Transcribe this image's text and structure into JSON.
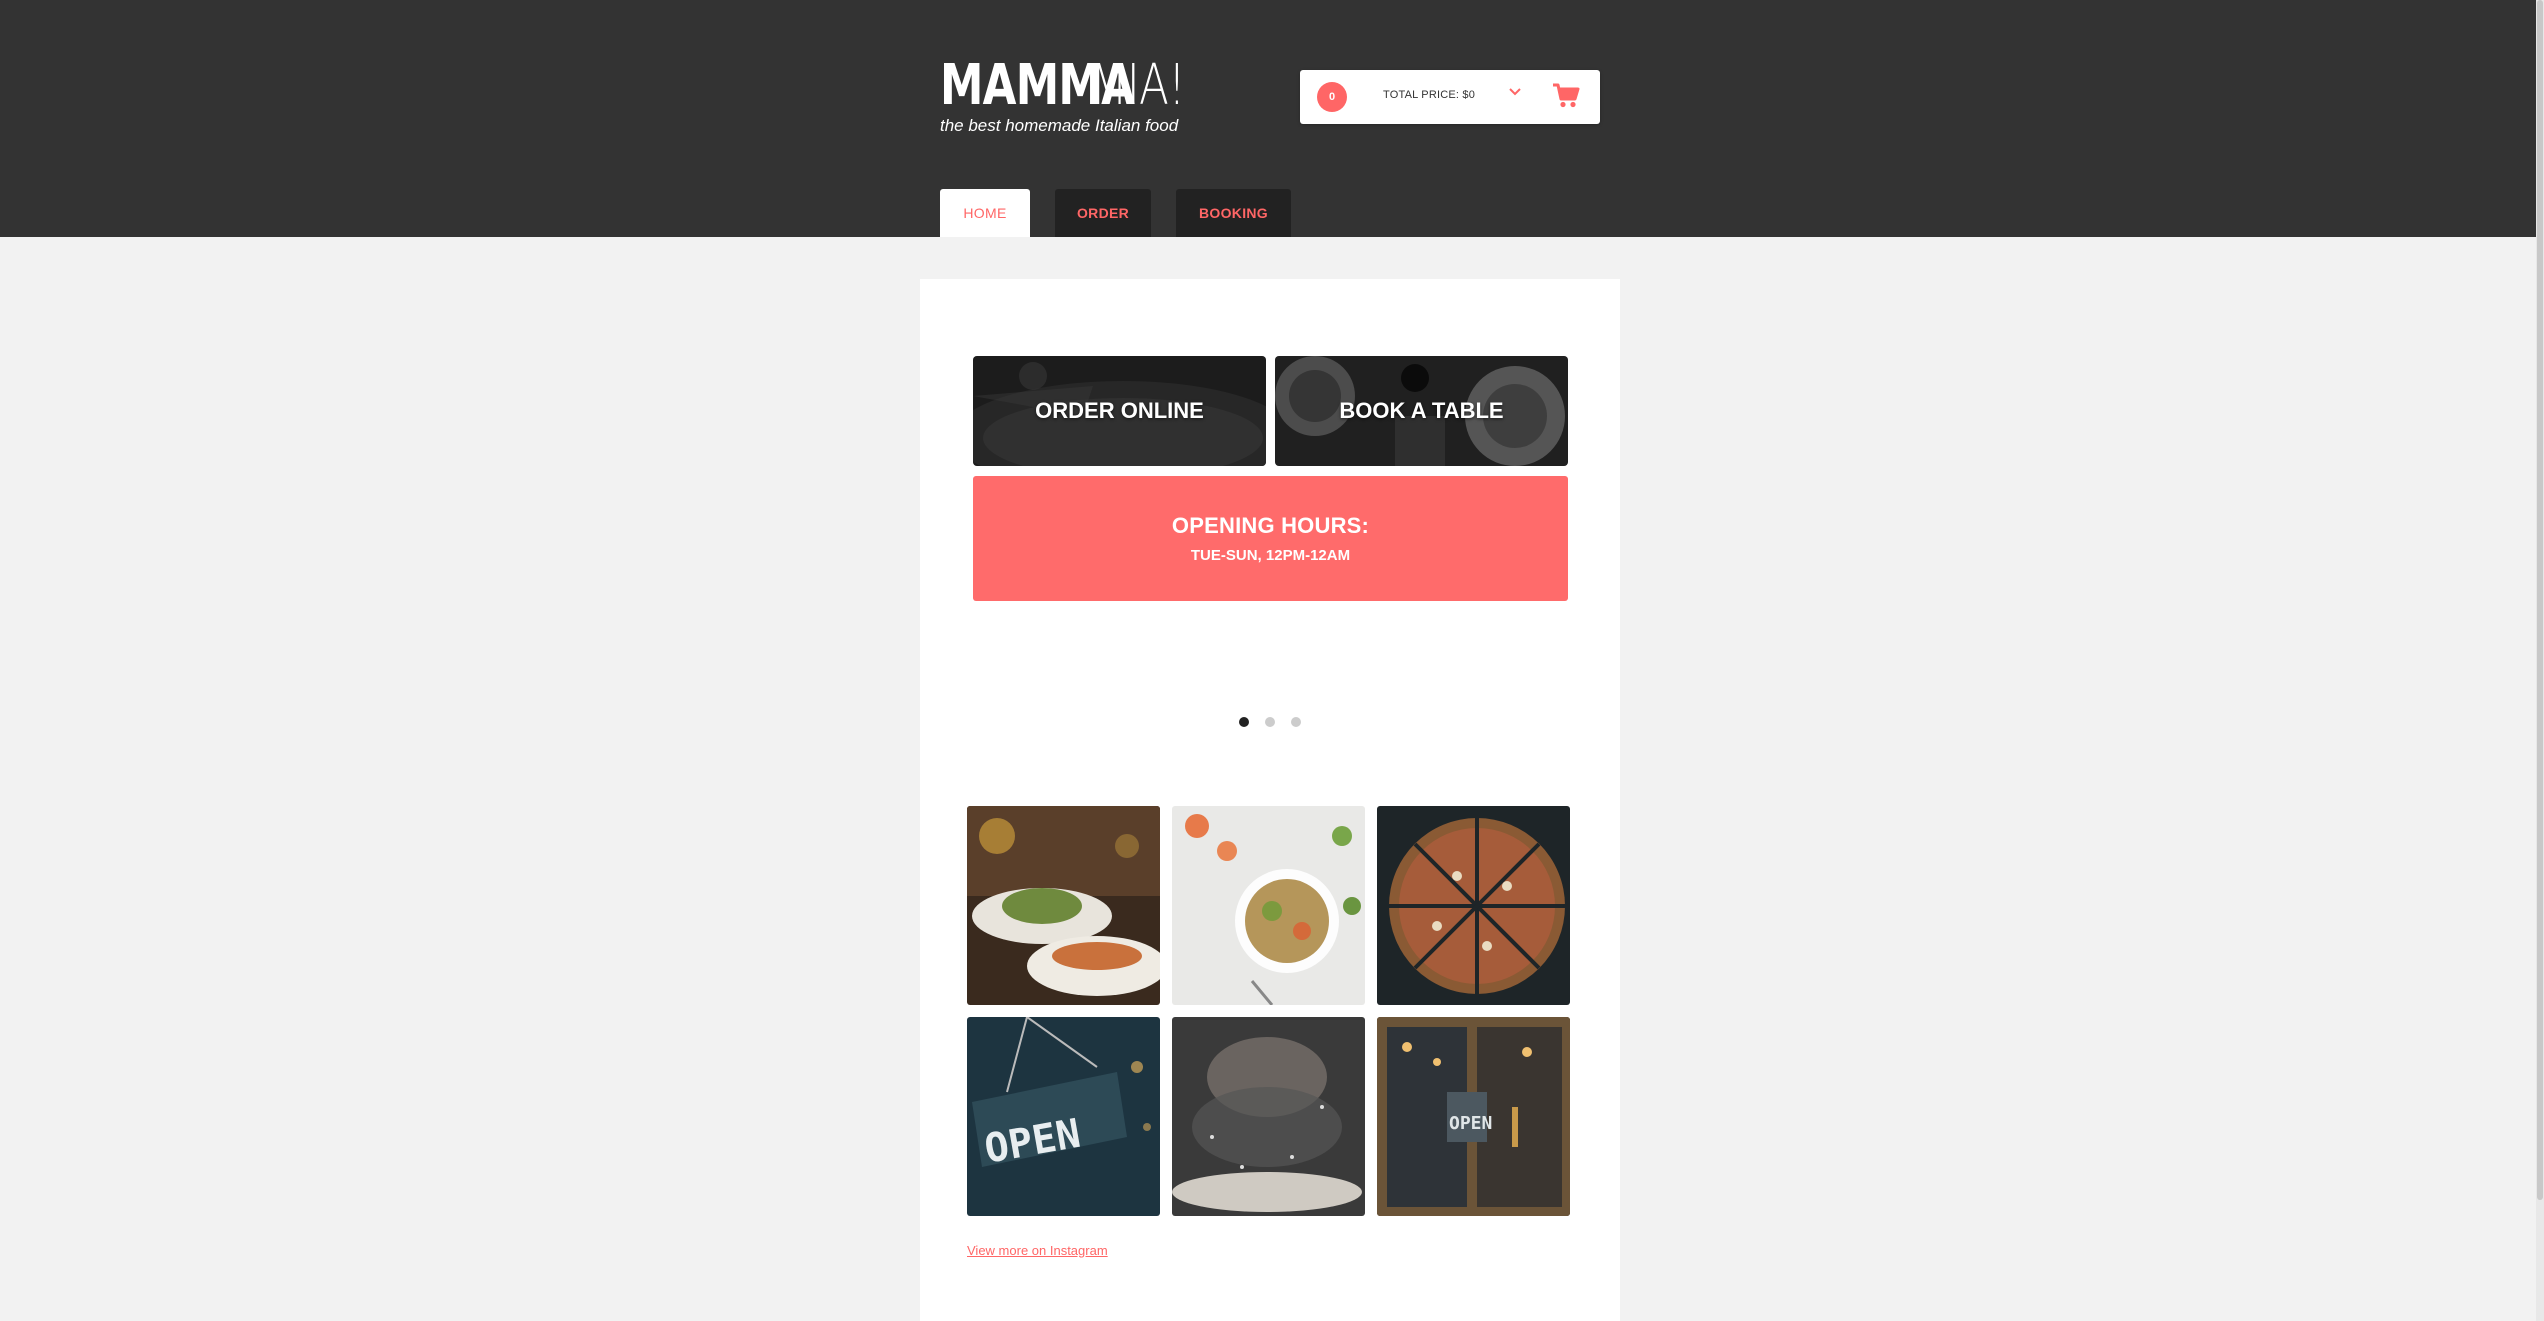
{
  "brand": {
    "name_strong": "MAMMA",
    "name_light": "MIA!",
    "tagline": "the best homemade Italian food"
  },
  "cart": {
    "count": "0",
    "total_label": "TOTAL PRICE: $0",
    "chevron_icon": "chevron-down-icon",
    "cart_icon": "shopping-cart-icon"
  },
  "tabs": [
    {
      "label": "HOME",
      "active": true
    },
    {
      "label": "ORDER",
      "active": false
    },
    {
      "label": "BOOKING",
      "active": false
    }
  ],
  "promos": {
    "order": "ORDER ONLINE",
    "book": "BOOK A TABLE"
  },
  "hours": {
    "title": "OPENING HOURS:",
    "time": "TUE-SUN, 12PM-12AM"
  },
  "carousel": {
    "slides": 3,
    "active_index": 0
  },
  "gallery": {
    "photos": [
      "restaurant-dishes",
      "salad-bowl",
      "sliced-pizza",
      "open-sign",
      "dough-flour",
      "open-door"
    ]
  },
  "instagram": {
    "link": "View more on Instagram"
  },
  "colors": {
    "accent": "#ff6666",
    "header_bg": "#333333",
    "page_bg": "#f2f2f2",
    "hours_bg": "#ff6b6b"
  }
}
